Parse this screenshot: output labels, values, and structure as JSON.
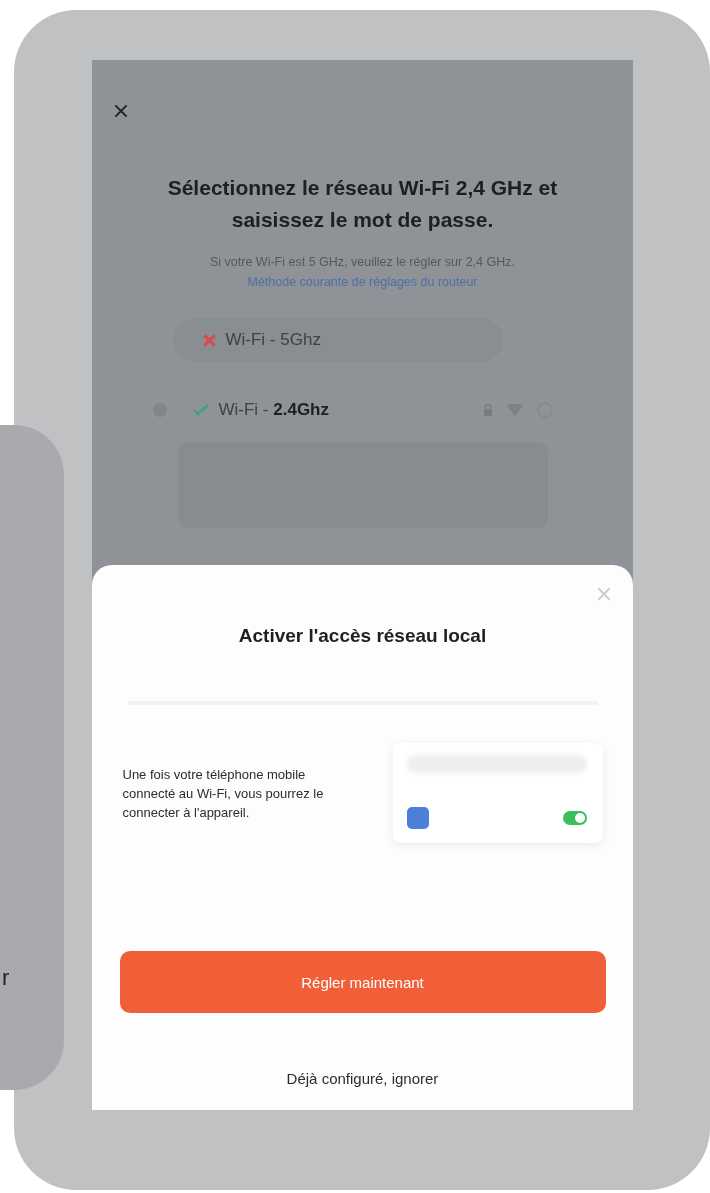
{
  "background_card": {
    "text": "r"
  },
  "wifi_screen": {
    "title": "Sélectionnez le réseau Wi-Fi 2,4 GHz et saisissez le mot de passe.",
    "hint": "Si votre Wi-Fi est 5 GHz, veuillez le régler sur 2,4 GHz.",
    "hint_link": "Méthode courante de réglages du routeur",
    "networks": [
      {
        "name": "Wi-Fi - 5Ghz",
        "supported": false
      },
      {
        "name": "Wi-Fi - **2.4Ghz**",
        "supported": true
      }
    ]
  },
  "sheet": {
    "title": "Activer l'accès réseau local",
    "description": "Une fois votre téléphone mobile connecté au Wi-Fi, vous pourrez le connecter à l'appareil.",
    "illustration": {
      "toggle_on": true
    },
    "primary_button": "Régler maintenant",
    "secondary_link": "Déjà configuré, ignorer"
  }
}
